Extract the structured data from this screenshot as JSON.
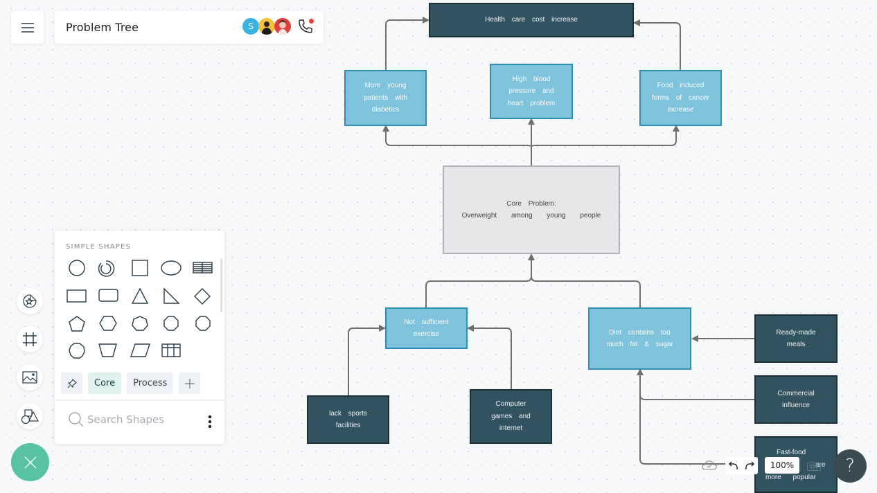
{
  "header": {
    "menu_icon": "hamburger-menu-icon",
    "title": "Problem Tree",
    "collaborators": [
      {
        "initial": "S",
        "color": "#3bb3e0"
      },
      {
        "initial": "",
        "color": "#f3c13a"
      },
      {
        "initial": "",
        "color": "#e23d3d"
      }
    ],
    "call_icon": "phone-call-icon",
    "call_status_color": "#ea3b3b"
  },
  "shapes_panel": {
    "heading": "SIMPLE SHAPES",
    "shapes": [
      "circle",
      "donut",
      "square",
      "ellipse",
      "table",
      "rectangle",
      "rounded-rectangle",
      "triangle",
      "right-triangle",
      "diamond",
      "pentagon",
      "hexagon",
      "heptagon",
      "octagon",
      "nonagon",
      "decagon",
      "trapezoid",
      "parallelogram",
      "grid"
    ],
    "tabs": [
      {
        "label": "",
        "icon": "pin-icon"
      },
      {
        "label": "Core",
        "active": true
      },
      {
        "label": "Process"
      },
      {
        "label": "",
        "icon": "plus-icon"
      }
    ],
    "search_placeholder": "Search Shapes"
  },
  "left_toolbar": [
    {
      "name": "templates",
      "icon": "sticker-star-icon"
    },
    {
      "name": "frames",
      "icon": "frame-icon"
    },
    {
      "name": "images",
      "icon": "image-icon"
    },
    {
      "name": "shapes",
      "icon": "shapes-icon"
    }
  ],
  "diagram": {
    "colors": {
      "dark": "#31525f",
      "blue": "#7ec2dc",
      "core": "#e8e6e9",
      "connector": "#6e6e6e"
    },
    "nodes": {
      "effect_top": "Health care cost increase",
      "effect_diabetes": "More young patients with diabetics",
      "effect_blood": "High blood pressure and heart problem",
      "effect_cancer": "Food induced forms of cancer increase",
      "core_title": "Core Problem:",
      "core_text": "Overweight among young people",
      "cause_exercise": "Not sufficient exercise",
      "cause_diet": "Diet contains too much fat & sugar",
      "root_sports": "lack sports facilities",
      "root_computer": "Computer games and internet",
      "root_ready": "Ready-made meals",
      "root_commercial": "Commercial influence",
      "root_fastfood_1": "Fast-food",
      "root_fastfood_2": "are",
      "root_fastfood_3": "more popular"
    }
  },
  "bottom_controls": {
    "save_status_icon": "cloud-saved-icon",
    "undo_icon": "undo-icon",
    "redo_icon": "redo-icon",
    "zoom_level": "100%",
    "keyboard_icon": "keyboard-icon",
    "help_label": "?"
  }
}
